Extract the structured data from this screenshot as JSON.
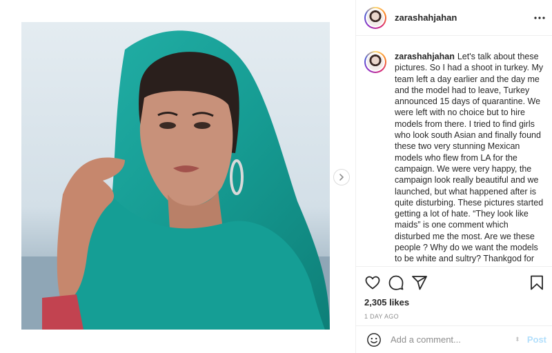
{
  "post": {
    "username": "zarashahjahan",
    "caption_username": "zarashahjahan",
    "caption": "Let's talk about these pictures. So I had a shoot in turkey. My team left a day earlier and the day me and the model had to leave, Turkey announced 15 days of quarantine. We were left with no choice but to hire models from there. I tried to find girls who look south Asian and finally found these two very stunning Mexican models who flew from LA for the campaign. We were very happy, the campaign look really beautiful and we launched, but what happened after is quite disturbing. These pictures started getting a lot of hate. “They look like maids” is one comment which disturbed me the most. Are we these people ? Why do we want the models to be white and sultry? Thankgod for my loyal customers who",
    "likes": "2,305 likes",
    "date": "1 DAY AGO"
  },
  "comment_box": {
    "placeholder": "Add a comment...",
    "post_label": "Post"
  },
  "icons": {
    "more": "more-icon",
    "like": "heart-icon",
    "comment": "comment-icon",
    "share": "share-icon",
    "save": "bookmark-icon",
    "emoji": "emoji-icon",
    "next": "chevron-right-icon"
  },
  "colors": {
    "scarf": "#1aa39b",
    "link_blue_disabled": "#b2dffc",
    "muted": "#8e8e8e"
  }
}
